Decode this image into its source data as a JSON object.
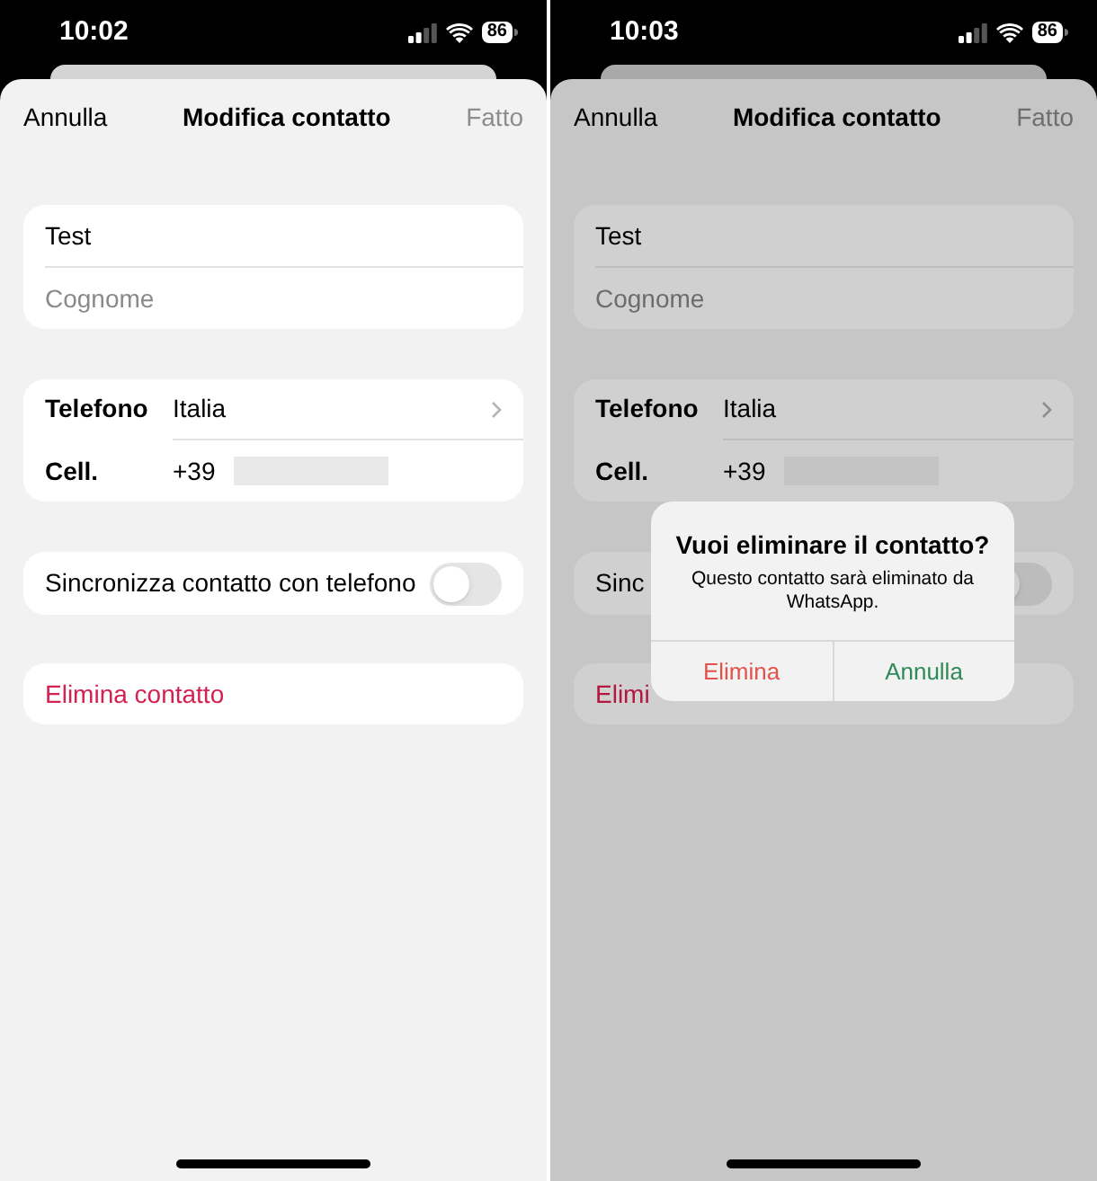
{
  "screens": [
    {
      "dimmed": false,
      "status_bar": {
        "time": "10:02",
        "battery": "86"
      },
      "nav": {
        "cancel": "Annulla",
        "title": "Modifica contatto",
        "done": {
          "label": "Fatto",
          "disabled": true
        }
      },
      "name_card": {
        "first_name": "Test",
        "last_name_placeholder": "Cognome"
      },
      "phone_card": {
        "label": "Telefono",
        "country": "Italia",
        "type": "Cell.",
        "prefix": "+39"
      },
      "sync": {
        "label": "Sincronizza contatto con telefono",
        "on": false
      },
      "delete": "Elimina contatto"
    },
    {
      "dimmed": true,
      "status_bar": {
        "time": "10:03",
        "battery": "86"
      },
      "nav": {
        "cancel": "Annulla",
        "title": "Modifica contatto",
        "done": {
          "label": "Fatto",
          "disabled": true
        }
      },
      "name_card": {
        "first_name": "Test",
        "last_name_placeholder": "Cognome"
      },
      "phone_card": {
        "label": "Telefono",
        "country": "Italia",
        "type": "Cell.",
        "prefix": "+39"
      },
      "sync": {
        "label": "Sinc",
        "on": false
      },
      "delete": "Elimi",
      "dialog": {
        "title": "Vuoi eliminare il contatto?",
        "message": "Questo contatto sarà eliminato da WhatsApp.",
        "buttons": [
          {
            "label": "Elimina",
            "kind": "destructive"
          },
          {
            "label": "Annulla",
            "kind": "confirm"
          }
        ]
      }
    }
  ]
}
